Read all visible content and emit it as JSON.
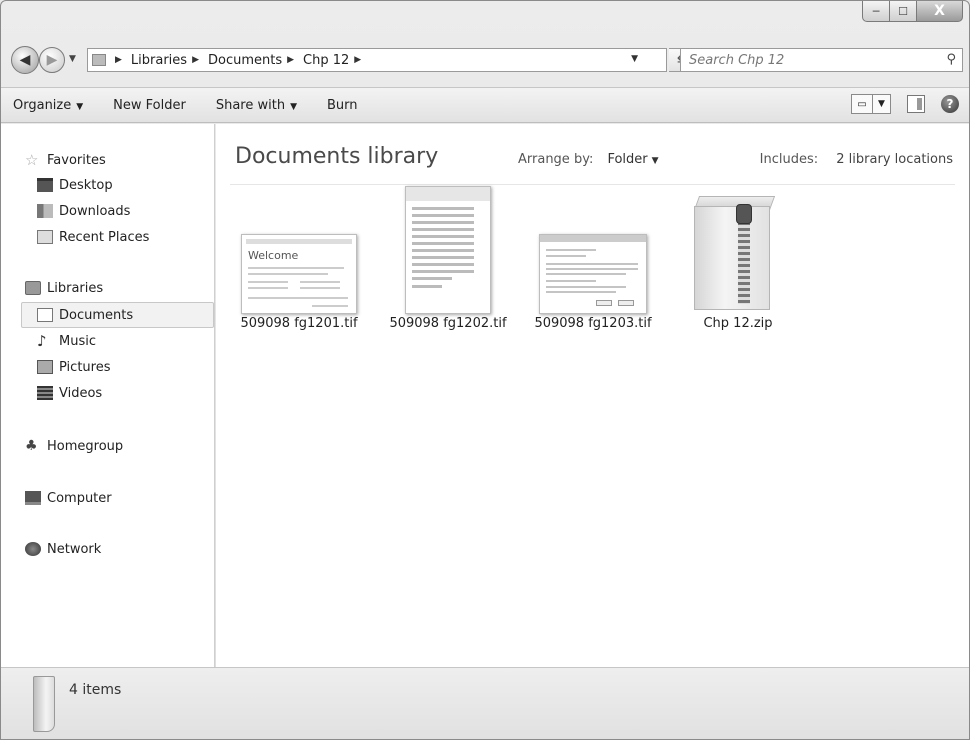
{
  "window": {
    "caption": {
      "minimize": "─",
      "maximize": "☐",
      "close": "X"
    }
  },
  "nav": {
    "breadcrumbs": [
      "Libraries",
      "Documents",
      "Chp 12"
    ],
    "search_placeholder": "Search Chp 12"
  },
  "toolbar": {
    "organize": "Organize",
    "new_folder": "New Folder",
    "share_with": "Share with",
    "burn": "Burn"
  },
  "sidebar": {
    "favorites": {
      "label": "Favorites",
      "items": [
        "Desktop",
        "Downloads",
        "Recent Places"
      ]
    },
    "libraries": {
      "label": "Libraries",
      "items": [
        "Documents",
        "Music",
        "Pictures",
        "Videos"
      ],
      "selected": "Documents"
    },
    "homegroup": "Homegroup",
    "computer": "Computer",
    "network": "Network"
  },
  "content": {
    "title": "Documents library",
    "arrange_label": "Arrange by:",
    "arrange_value": "Folder",
    "includes_label": "Includes:",
    "includes_value": "2 library locations",
    "files": [
      {
        "name": "509098 fg1201.tif",
        "thumb_text": "Welcome"
      },
      {
        "name": "509098 fg1202.tif"
      },
      {
        "name": "509098 fg1203.tif"
      },
      {
        "name": "Chp 12.zip"
      }
    ]
  },
  "status": {
    "count": "4 items"
  }
}
